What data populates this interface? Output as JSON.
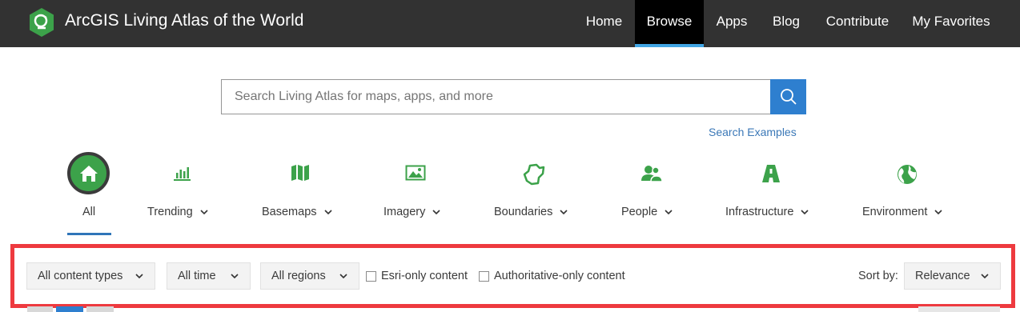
{
  "header": {
    "title": "ArcGIS Living Atlas of the World",
    "nav": [
      {
        "label": "Home",
        "active": false
      },
      {
        "label": "Browse",
        "active": true
      },
      {
        "label": "Apps",
        "active": false
      },
      {
        "label": "Blog",
        "active": false
      },
      {
        "label": "Contribute",
        "active": false
      },
      {
        "label": "My Favorites",
        "active": false
      }
    ],
    "colors": {
      "bar": "#323232",
      "active_tab": "#000000",
      "active_underline": "#41a5e4",
      "logo": "#3ca24a"
    }
  },
  "search": {
    "placeholder": "Search Living Atlas for maps, apps, and more",
    "examples_link": "Search Examples",
    "button_icon": "search-icon"
  },
  "categories": [
    {
      "label": "All",
      "icon": "home-icon",
      "selected": true
    },
    {
      "label": "Trending",
      "icon": "bar-chart-icon"
    },
    {
      "label": "Basemaps",
      "icon": "map-icon"
    },
    {
      "label": "Imagery",
      "icon": "image-icon"
    },
    {
      "label": "Boundaries",
      "icon": "boundary-icon"
    },
    {
      "label": "People",
      "icon": "people-icon"
    },
    {
      "label": "Infrastructure",
      "icon": "road-icon"
    },
    {
      "label": "Environment",
      "icon": "globe-icon"
    }
  ],
  "filters": {
    "content_types": "All content types",
    "time": "All time",
    "regions": "All regions",
    "esri_only": {
      "label": "Esri-only content",
      "checked": false
    },
    "authoritative_only": {
      "label": "Authoritative-only content",
      "checked": false
    },
    "sort_label": "Sort by:",
    "sort_value": "Relevance",
    "highlight_color": "#ee3a3f"
  }
}
